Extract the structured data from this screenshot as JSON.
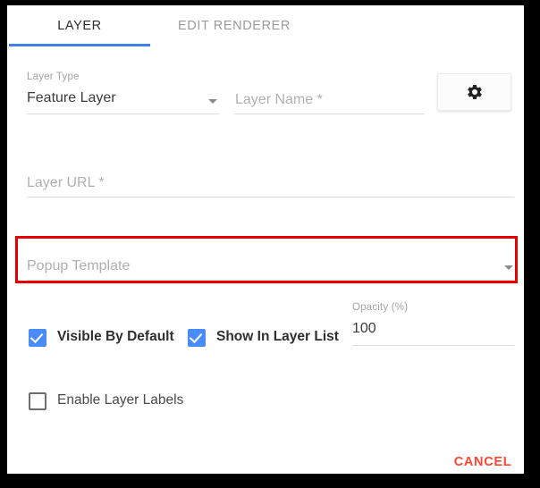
{
  "dialog": {
    "tabs": [
      {
        "label": "LAYER",
        "active": true
      },
      {
        "label": "EDIT RENDERER",
        "active": false
      }
    ],
    "layer_type": {
      "label": "Layer Type",
      "value": "Feature Layer",
      "caret_icon": "chevron-down-icon"
    },
    "layer_name": {
      "placeholder": "Layer Name *",
      "value": ""
    },
    "settings_button": {
      "icon": "gear-icon"
    },
    "layer_url": {
      "placeholder": "Layer URL *",
      "value": ""
    },
    "popup_template": {
      "placeholder": "Popup Template",
      "value": "",
      "caret_icon": "chevron-down-icon",
      "highlight_color": "#e60000",
      "highlighted": true
    },
    "checkboxes": [
      {
        "label": "Visible By Default",
        "checked": true
      },
      {
        "label": "Show In Layer List",
        "checked": true
      },
      {
        "label": "Enable Layer Labels",
        "checked": false
      }
    ],
    "opacity": {
      "label": "Opacity (%)",
      "value": "100"
    },
    "cancel_button": {
      "label": "CANCEL"
    },
    "colors": {
      "accent": "#3f7fe8",
      "checkbox": "#4a8cf7",
      "cancel": "#ff4533",
      "highlight": "#e60000"
    }
  }
}
